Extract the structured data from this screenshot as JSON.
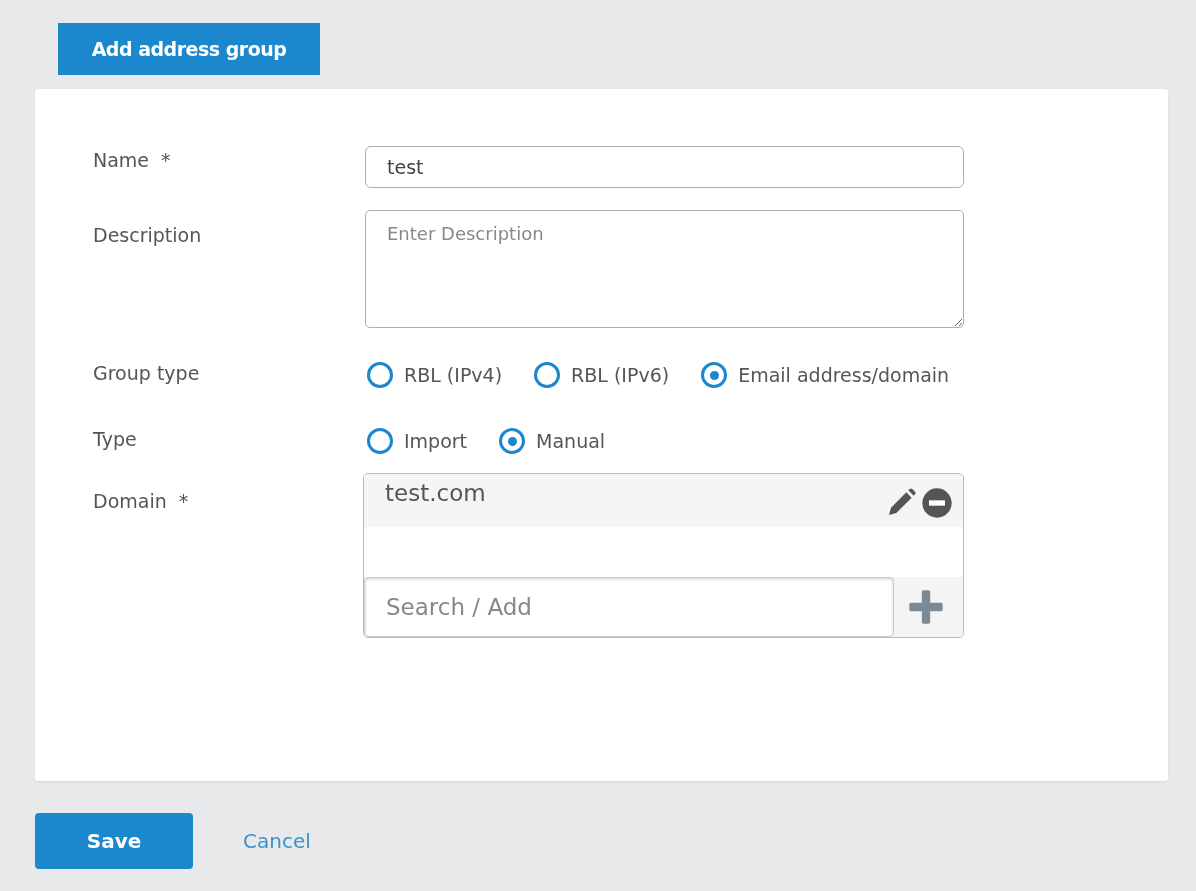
{
  "header_button": "Add address group",
  "fields": [
    {
      "label": "Name",
      "required": true,
      "value": "test"
    },
    {
      "label": "Description",
      "required": false,
      "placeholder": "Enter Description"
    }
  ],
  "radio_groups": [
    {
      "label": "Group type",
      "options": [
        {
          "label": "RBL (IPv4)",
          "selected": false
        },
        {
          "label": "RBL (IPv6)",
          "selected": false
        },
        {
          "label": "Email address/domain",
          "selected": true
        }
      ]
    },
    {
      "label": "Type",
      "options": [
        {
          "label": "Import",
          "selected": false
        },
        {
          "label": "Manual",
          "selected": true
        }
      ]
    }
  ],
  "domain": {
    "label": "Domain",
    "required": true,
    "items": [
      "test.com"
    ],
    "search_placeholder": "Search / Add"
  },
  "required_mark": "*",
  "buttons": {
    "save": "Save",
    "cancel": "Cancel"
  }
}
